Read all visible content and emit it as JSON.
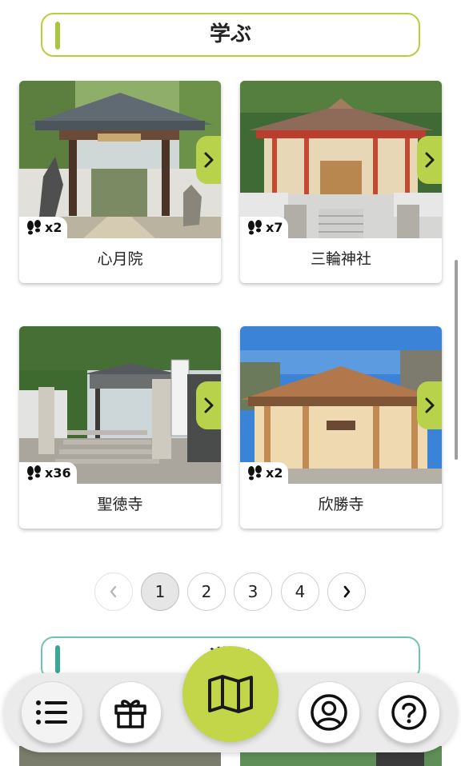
{
  "section_learn": {
    "title": "学ぶ"
  },
  "section_next": {
    "title": "遊ぶ"
  },
  "cards": [
    {
      "name": "心月院",
      "count": "x2"
    },
    {
      "name": "三輪神社",
      "count": "x7"
    },
    {
      "name": "聖徳寺",
      "count": "x36"
    },
    {
      "name": "欣勝寺",
      "count": "x2"
    }
  ],
  "pagination": {
    "prev": "‹",
    "pages": [
      "1",
      "2",
      "3",
      "4"
    ],
    "current": "1",
    "next": "›"
  },
  "nav": {
    "items": [
      {
        "icon": "list-icon",
        "selected": true
      },
      {
        "icon": "gift-icon"
      },
      {
        "icon": "map-icon",
        "primary": true
      },
      {
        "icon": "user-icon"
      },
      {
        "icon": "help-icon"
      }
    ]
  },
  "colors": {
    "accent": "#b9d24b",
    "accent_dark": "#a7c63c",
    "teal": "#3aa896",
    "map_button": "#c3d64a"
  }
}
